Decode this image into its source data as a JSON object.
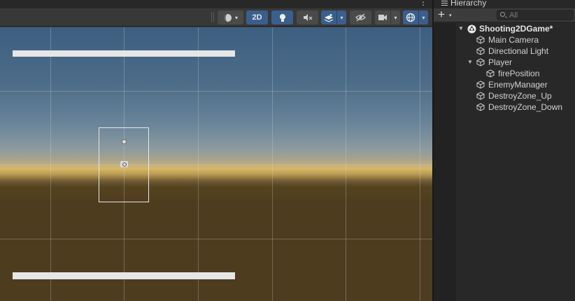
{
  "scene_view": {
    "menu_glyph": "⋮",
    "toolbar": {
      "shading_mode_icon": "sphere-shading-icon",
      "mode_2d_label": "2D",
      "lighting_icon": "lightbulb-icon",
      "audio_icon": "audio-mute-icon",
      "effects_icon": "effects-layers-icon",
      "visibility_icon": "hidden-eye-icon",
      "camera_icon": "camera-icon",
      "gizmos_icon": "gizmo-globe-icon",
      "dropdown_glyph": "▾"
    },
    "colors": {
      "toolbar_active": "#3a5f8c",
      "sky_top": "#3d5f80",
      "horizon": "#d8b867",
      "ground": "#4e3c1f"
    }
  },
  "hierarchy": {
    "tab_label": "Hierarchy",
    "tab_icon": "list-icon",
    "add_button_label": "+",
    "add_caret": "▾",
    "search_placeholder": "All",
    "items": [
      {
        "label": "Shooting2DGame*",
        "icon": "unity-scene-icon",
        "expanded": true
      },
      {
        "label": "Main Camera",
        "icon": "gameobject-cube-icon"
      },
      {
        "label": "Directional Light",
        "icon": "gameobject-cube-icon"
      },
      {
        "label": "Player",
        "icon": "gameobject-cube-icon",
        "expanded": true
      },
      {
        "label": "firePosition",
        "icon": "gameobject-cube-icon"
      },
      {
        "label": "EnemyManager",
        "icon": "gameobject-cube-icon"
      },
      {
        "label": "DestroyZone_Up",
        "icon": "gameobject-cube-icon"
      },
      {
        "label": "DestroyZone_Down",
        "icon": "gameobject-cube-icon"
      }
    ]
  }
}
